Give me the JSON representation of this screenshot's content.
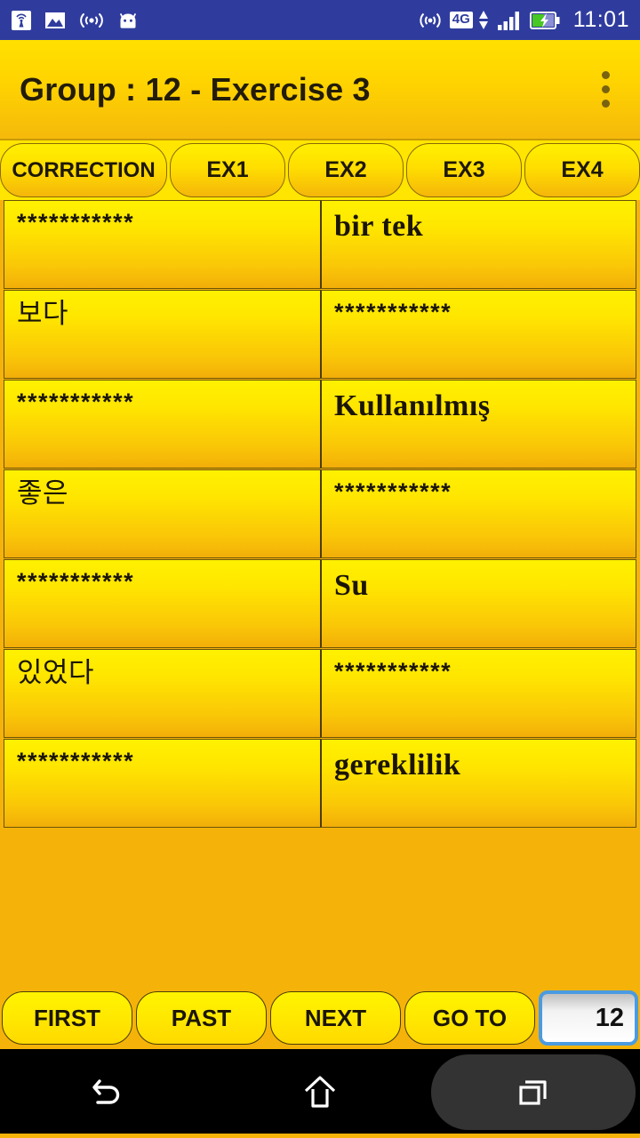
{
  "statusbar": {
    "clock": "11:01",
    "network_label": "4G",
    "icons_left": [
      "broadcast-tower-icon",
      "photo-icon",
      "wifi-waves-icon",
      "android-robot-icon"
    ],
    "icons_right": [
      "hotspot-icon",
      "network-4g-icon",
      "signal-bars-icon",
      "battery-charging-icon"
    ]
  },
  "header": {
    "title": "Group : 12 - Exercise 3",
    "overflow_label": "overflow-menu"
  },
  "tabs": [
    {
      "label": "CORRECTION",
      "selected": true
    },
    {
      "label": "EX1",
      "selected": false
    },
    {
      "label": "EX2",
      "selected": false
    },
    {
      "label": "EX3",
      "selected": false
    },
    {
      "label": "EX4",
      "selected": false
    }
  ],
  "table": {
    "rows": [
      {
        "left": "***********",
        "right": "bir tek",
        "left_lang": "stars",
        "right_lang": "tr"
      },
      {
        "left": "보다",
        "right": "***********",
        "left_lang": "kr",
        "right_lang": "stars"
      },
      {
        "left": "***********",
        "right": "Kullanılmış",
        "left_lang": "stars",
        "right_lang": "tr"
      },
      {
        "left": "좋은",
        "right": "***********",
        "left_lang": "kr",
        "right_lang": "stars"
      },
      {
        "left": "***********",
        "right": "Su",
        "left_lang": "stars",
        "right_lang": "tr"
      },
      {
        "left": "있었다",
        "right": "***********",
        "left_lang": "kr",
        "right_lang": "stars"
      },
      {
        "left": "***********",
        "right": "gereklilik",
        "left_lang": "stars",
        "right_lang": "tr"
      }
    ]
  },
  "bottom": {
    "first_label": "FIRST",
    "past_label": "PAST",
    "next_label": "NEXT",
    "goto_label": "GO TO",
    "page_value": "12",
    "page_placeholder": "12"
  },
  "navbar": {
    "back_label": "back-icon",
    "home_label": "home-icon",
    "recents_label": "recents-icon"
  },
  "colors": {
    "statusbar_blue": "#2F3C9E",
    "header_yellow": "#FFD400",
    "background_amber": "#F5B30A",
    "cell_yellow": "#FFE600",
    "text_dark": "#1B1504",
    "input_border_blue": "#4A9BE0"
  }
}
